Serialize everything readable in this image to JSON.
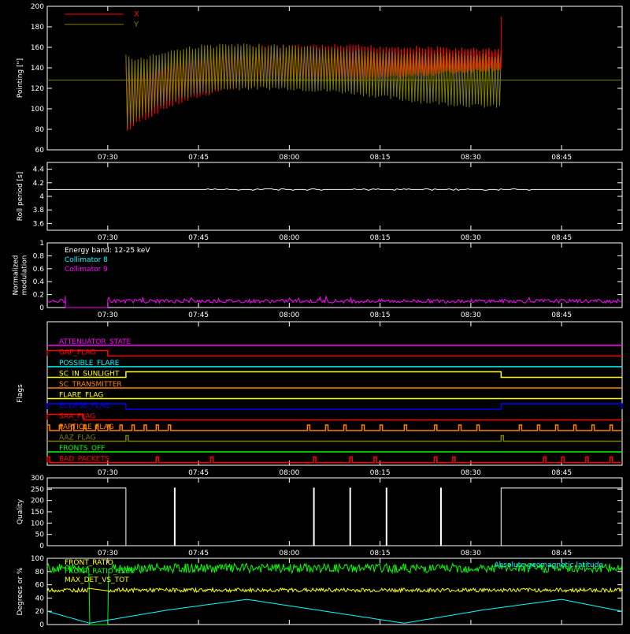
{
  "time_ticks": [
    "07:30",
    "07:45",
    "08:00",
    "08:15",
    "08:30",
    "08:45"
  ],
  "chart_data": [
    {
      "type": "line",
      "panel": "pointing",
      "ylabel": "Pointing [\"]",
      "ylim": [
        60,
        200
      ],
      "yticks": [
        60,
        80,
        100,
        120,
        140,
        160,
        180,
        200
      ],
      "legend": [
        {
          "name": "X",
          "color": "#ff0000"
        },
        {
          "name": "Y",
          "color": "#808000"
        }
      ],
      "series": [
        {
          "name": "X",
          "color": "#ff0000",
          "x": [
            "07:33",
            "07:35",
            "07:40",
            "07:45",
            "07:50",
            "08:00",
            "08:10",
            "08:20",
            "08:30",
            "08:35"
          ],
          "upper": [
            150,
            145,
            153,
            158,
            161,
            163,
            163,
            162,
            160,
            160
          ],
          "lower": [
            75,
            85,
            100,
            110,
            118,
            122,
            125,
            130,
            135,
            137
          ]
        },
        {
          "name": "Y",
          "color": "#808000",
          "x": [
            "07:33",
            "07:35",
            "07:40",
            "07:45",
            "07:50",
            "08:00",
            "08:10",
            "08:20",
            "08:30",
            "08:35"
          ],
          "upper": [
            155,
            150,
            158,
            163,
            164,
            163,
            159,
            156,
            154,
            154
          ],
          "lower": [
            78,
            90,
            105,
            113,
            118,
            118,
            114,
            106,
            101,
            100
          ]
        }
      ],
      "reference_line": 128
    },
    {
      "type": "line",
      "panel": "roll-period",
      "ylabel": "Roll period [s]",
      "ylim": [
        3.5,
        4.5
      ],
      "yticks": [
        3.6,
        3.8,
        4.0,
        4.2,
        4.4
      ],
      "series": [
        {
          "name": "",
          "color": "#ffffff",
          "value": 4.1
        }
      ]
    },
    {
      "type": "line",
      "panel": "modulation",
      "ylabel": "Normalized modulation",
      "ylim": [
        0,
        1
      ],
      "yticks": [
        0.0,
        0.2,
        0.4,
        0.6,
        0.8,
        1.0
      ],
      "annotation": "Energy band: 12-25 keV",
      "legend": [
        {
          "name": "Collimator 8",
          "color": "#00ffff"
        },
        {
          "name": "Collimator 9",
          "color": "#ff00ff"
        }
      ],
      "series": [
        {
          "name": "Collimator 9",
          "color": "#ff00ff",
          "level": 0.1,
          "gap": [
            "07:23",
            "07:30"
          ]
        }
      ]
    },
    {
      "type": "line",
      "panel": "flags",
      "ylabel": "Flags",
      "flags": [
        {
          "name": "ATTENUATOR_STATE",
          "color": "#ff00ff",
          "segments": []
        },
        {
          "name": "GAP_FLAG",
          "color": "#ff0000",
          "segments": [
            [
              "07:20",
              "07:30"
            ]
          ]
        },
        {
          "name": "POSSIBLE_FLARE",
          "color": "#00ffff",
          "segments": []
        },
        {
          "name": "SC_IN_SUNLIGHT",
          "color": "#ffff00",
          "segments": [
            [
              "07:33",
              "08:35"
            ]
          ]
        },
        {
          "name": "SC_TRANSMITTER",
          "color": "#ff8000",
          "segments": []
        },
        {
          "name": "FLARE_FLAG",
          "color": "#ffff00",
          "segments": []
        },
        {
          "name": "ECLIPSE_FLAG",
          "color": "#0000ff",
          "segments": [
            [
              "07:20",
              "07:33"
            ],
            [
              "08:35",
              "08:55"
            ]
          ]
        },
        {
          "name": "SAA_FLAG",
          "color": "#ff0000",
          "segments": [
            [
              "07:20",
              "07:26"
            ]
          ]
        },
        {
          "name": "PARTICLE_FLAG",
          "color": "#ff8000",
          "pulses": [
            "07:20",
            "07:22",
            "07:24",
            "07:26",
            "07:28",
            "07:30",
            "07:32",
            "07:34",
            "07:36",
            "07:38",
            "07:40",
            "08:03",
            "08:06",
            "08:09",
            "08:12",
            "08:15",
            "08:19",
            "08:24",
            "08:28",
            "08:31",
            "08:38",
            "08:41",
            "08:44",
            "08:47",
            "08:50",
            "08:53"
          ]
        },
        {
          "name": "AAZ_FLAG",
          "color": "#808000",
          "pulses": [
            "07:33",
            "08:35"
          ]
        },
        {
          "name": "FRONTS_OFF",
          "color": "#00ff00",
          "segments": []
        },
        {
          "name": "BAD_PACKETS",
          "color": "#ff0000",
          "pulses": [
            "07:20",
            "07:38",
            "07:47",
            "08:04",
            "08:10",
            "08:14",
            "08:24",
            "08:27",
            "08:42",
            "08:45",
            "08:49",
            "08:53"
          ]
        }
      ]
    },
    {
      "type": "line",
      "panel": "quality",
      "ylabel": "Quality",
      "ylim": [
        0,
        300
      ],
      "yticks": [
        0,
        50,
        100,
        150,
        200,
        250,
        300
      ],
      "series": [
        {
          "name": "",
          "color": "#ffffff",
          "high_segments": [
            [
              "07:20",
              "07:33"
            ],
            [
              "08:35",
              "08:55"
            ]
          ],
          "spikes": [
            "07:41",
            "08:04",
            "08:10",
            "08:16",
            "08:25"
          ],
          "high": 255
        }
      ]
    },
    {
      "type": "line",
      "panel": "degrees",
      "ylabel": "Degrees or %",
      "ylim": [
        0,
        100
      ],
      "yticks": [
        0,
        20,
        40,
        60,
        80,
        100
      ],
      "legend": [
        {
          "name": "FRONT_RATIO",
          "color": "#ffff00"
        },
        {
          "name": "FRONT_RATIO_1250",
          "color": "#00ff00"
        },
        {
          "name": "MAX_DET_VS_TOT",
          "color": "#ffff00"
        }
      ],
      "annotation": "Absolute geomagnetic latitude",
      "annotation_color": "#00ffff",
      "series": [
        {
          "name": "FRONT_RATIO_1250",
          "color": "#00ff00",
          "level": 85
        },
        {
          "name": "MAX_DET_VS_TOT",
          "color": "#ffff00",
          "level": 52
        },
        {
          "name": "Absolute geomagnetic latitude",
          "color": "#00ffff",
          "x": [
            "07:20",
            "07:27",
            "07:40",
            "07:53",
            "08:06",
            "08:19",
            "08:32",
            "08:45",
            "08:55"
          ],
          "y": [
            20,
            2,
            22,
            38,
            20,
            2,
            22,
            38,
            20
          ]
        }
      ]
    }
  ]
}
